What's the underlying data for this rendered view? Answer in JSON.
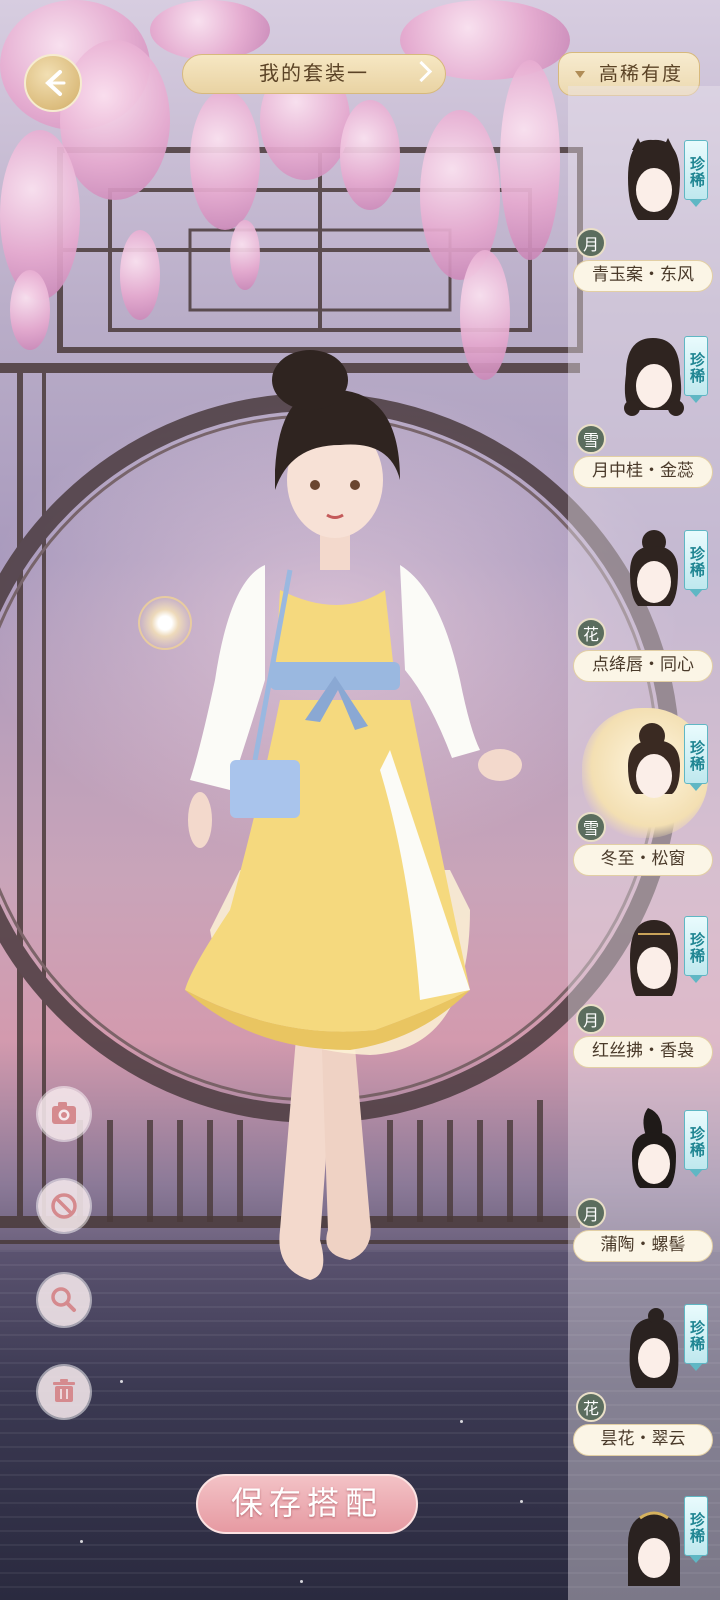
{
  "top_bar": {
    "outfit_title": "我的套装一",
    "sort_label": "高稀有度"
  },
  "hair_list": [
    {
      "name": "青玉案・东风",
      "season": "月",
      "rarity": "珍稀",
      "selected": false
    },
    {
      "name": "月中桂・金蕊",
      "season": "雪",
      "rarity": "珍稀",
      "selected": false
    },
    {
      "name": "点绛唇・同心",
      "season": "花",
      "rarity": "珍稀",
      "selected": false
    },
    {
      "name": "冬至・松窗",
      "season": "雪",
      "rarity": "珍稀",
      "selected": true
    },
    {
      "name": "红丝拂・香袅",
      "season": "月",
      "rarity": "珍稀",
      "selected": false
    },
    {
      "name": "蒲陶・螺髻",
      "season": "月",
      "rarity": "珍稀",
      "selected": false
    },
    {
      "name": "昙花・翠云",
      "season": "花",
      "rarity": "珍稀",
      "selected": false
    },
    {
      "name": "",
      "season": "",
      "rarity": "珍稀",
      "selected": false
    }
  ],
  "tools": [
    "camera-icon",
    "reset-icon",
    "zoom-icon",
    "trash-icon"
  ],
  "save_button": "保存搭配",
  "colors": {
    "accent_gold": "#e9d3a3",
    "rare_badge": "#5fb7c4",
    "save_pink": "#e69aa2",
    "dress_yellow": "#f5d97e",
    "sash_blue": "#9ab8e0"
  }
}
